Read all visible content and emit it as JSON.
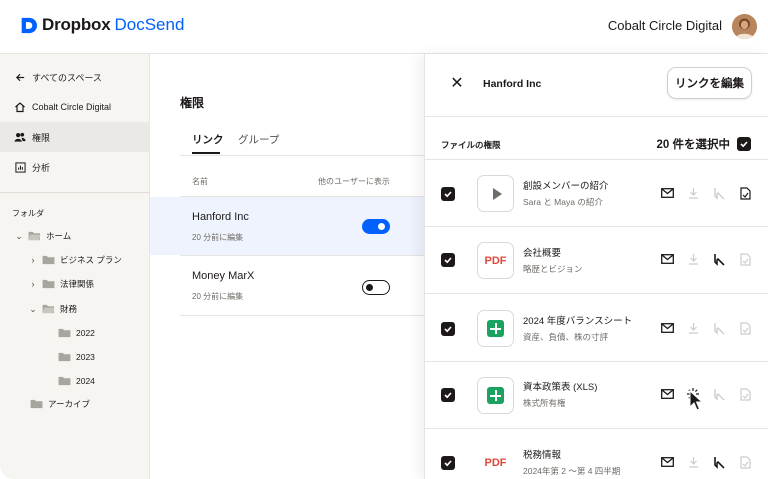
{
  "header": {
    "brand": "Dropbox",
    "product": "DocSend",
    "org_name": "Cobalt Circle Digital"
  },
  "sidebar": {
    "back_label": "すべてのスペース",
    "home_label": "Cobalt Circle Digital",
    "permissions_label": "権限",
    "analytics_label": "分析",
    "folders_title": "フォルダ",
    "tree": [
      {
        "label": "ホーム",
        "expanded": true
      },
      {
        "label": "ビジネス プラン",
        "expanded": false
      },
      {
        "label": "法律関係",
        "expanded": false
      },
      {
        "label": "財務",
        "expanded": true
      },
      {
        "label": "2022"
      },
      {
        "label": "2023"
      },
      {
        "label": "2024"
      },
      {
        "label": "アーカイブ"
      }
    ]
  },
  "main": {
    "title": "権限",
    "tabs": [
      {
        "label": "リンク",
        "active": true
      },
      {
        "label": "グループ",
        "active": false
      }
    ],
    "col_name": "名前",
    "col_visible": "他のユーザーに表示",
    "links": [
      {
        "name": "Hanford Inc",
        "edited": "20 分前に編集",
        "visible": true,
        "selected": true
      },
      {
        "name": "Money MarX",
        "edited": "20 分前に編集",
        "visible": false,
        "selected": false
      }
    ]
  },
  "panel": {
    "title": "Hanford Inc",
    "edit_button": "リンクを編集",
    "file_perms_title": "ファイルの権限",
    "selected_count": "20 件を選択中",
    "files": [
      {
        "name": "創設メンバーの紹介",
        "desc": "Sara と Maya の紹介",
        "thumb": "video",
        "checked": true
      },
      {
        "name": "会社概要",
        "desc": "略歴とビジョン",
        "thumb": "pdf",
        "checked": true
      },
      {
        "name": "2024 年度バランスシート",
        "desc": "資産、負債、株の寸評",
        "thumb": "sheet",
        "checked": true
      },
      {
        "name": "資本政策表 (XLS)",
        "desc": "株式所有権",
        "thumb": "sheet",
        "checked": true
      },
      {
        "name": "税務情報",
        "desc": "2024年第 2 〜第 4 四半期",
        "thumb": "pdf",
        "checked": true
      }
    ],
    "pdf_label": "PDF"
  },
  "colors": {
    "accent": "#0061fe",
    "text": "#1e1919",
    "sidebar_bg": "#f7f5f2",
    "selected_row": "#eef3fd",
    "pdf_red": "#e0493a",
    "sheet_green": "#1aa260"
  }
}
